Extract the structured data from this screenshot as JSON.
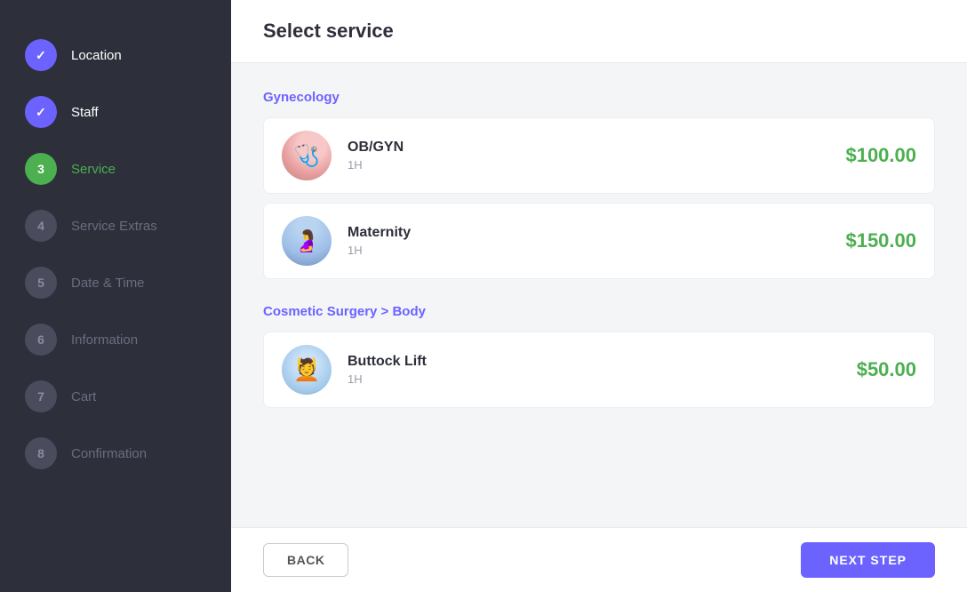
{
  "sidebar": {
    "items": [
      {
        "id": 1,
        "label": "Location",
        "state": "completed"
      },
      {
        "id": 2,
        "label": "Staff",
        "state": "completed"
      },
      {
        "id": 3,
        "label": "Service",
        "state": "active"
      },
      {
        "id": 4,
        "label": "Service Extras",
        "state": "inactive"
      },
      {
        "id": 5,
        "label": "Date & Time",
        "state": "inactive"
      },
      {
        "id": 6,
        "label": "Information",
        "state": "inactive"
      },
      {
        "id": 7,
        "label": "Cart",
        "state": "inactive"
      },
      {
        "id": 8,
        "label": "Confirmation",
        "state": "inactive"
      }
    ]
  },
  "header": {
    "title": "Select service"
  },
  "categories": [
    {
      "id": "gynecology",
      "label": "Gynecology",
      "services": [
        {
          "id": "obgyn",
          "name": "OB/GYN",
          "duration": "1H",
          "price": "$100.00",
          "thumb": "obgyn"
        },
        {
          "id": "maternity",
          "name": "Maternity",
          "duration": "1H",
          "price": "$150.00",
          "thumb": "maternity"
        }
      ]
    },
    {
      "id": "cosmetic-surgery",
      "label": "Cosmetic Surgery > Body",
      "services": [
        {
          "id": "buttock-lift",
          "name": "Buttock Lift",
          "duration": "1H",
          "price": "$50.00",
          "thumb": "buttock"
        }
      ]
    }
  ],
  "footer": {
    "back_label": "BACK",
    "next_label": "NEXT STEP"
  }
}
